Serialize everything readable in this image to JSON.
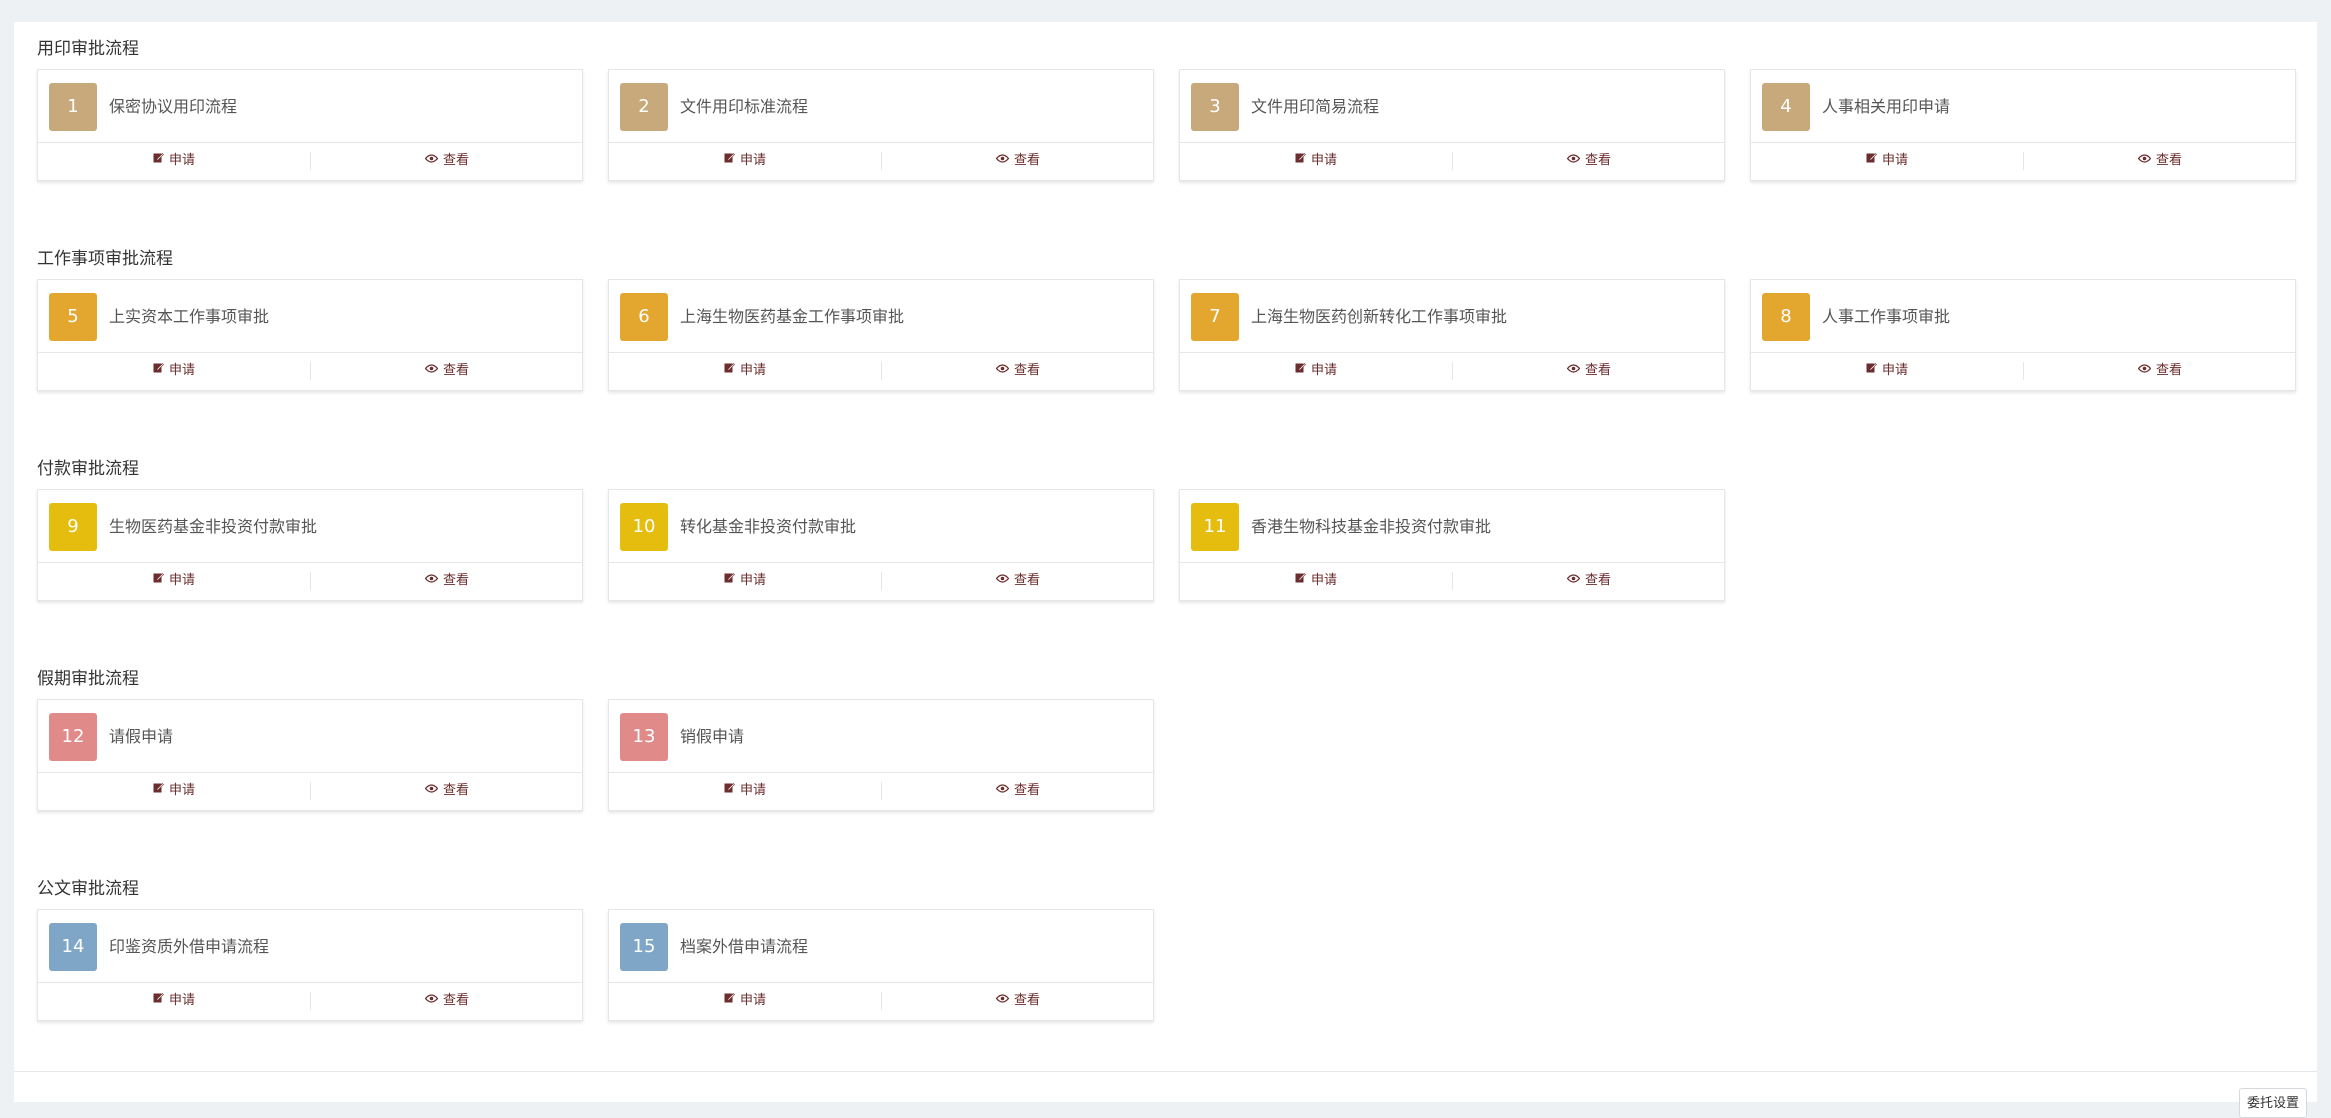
{
  "actions": {
    "apply": "申请",
    "view": "查看"
  },
  "colors": {
    "tan": "#c7a97c",
    "orange": "#e3a62f",
    "yellow": "#e4bd0e",
    "pink": "#e08a8a",
    "blue": "#7fa6c6"
  },
  "sections": [
    {
      "title": "用印审批流程",
      "color": "#c7a97c",
      "items": [
        {
          "num": "1",
          "name": "保密协议用印流程"
        },
        {
          "num": "2",
          "name": "文件用印标准流程"
        },
        {
          "num": "3",
          "name": "文件用印简易流程"
        },
        {
          "num": "4",
          "name": "人事相关用印申请"
        }
      ]
    },
    {
      "title": "工作事项审批流程",
      "color": "#e3a62f",
      "items": [
        {
          "num": "5",
          "name": "上实资本工作事项审批"
        },
        {
          "num": "6",
          "name": "上海生物医药基金工作事项审批"
        },
        {
          "num": "7",
          "name": "上海生物医药创新转化工作事项审批"
        },
        {
          "num": "8",
          "name": "人事工作事项审批"
        }
      ]
    },
    {
      "title": "付款审批流程",
      "color": "#e4bd0e",
      "items": [
        {
          "num": "9",
          "name": "生物医药基金非投资付款审批"
        },
        {
          "num": "10",
          "name": "转化基金非投资付款审批"
        },
        {
          "num": "11",
          "name": "香港生物科技基金非投资付款审批"
        }
      ]
    },
    {
      "title": "假期审批流程",
      "color": "#e08a8a",
      "items": [
        {
          "num": "12",
          "name": "请假申请"
        },
        {
          "num": "13",
          "name": "销假申请"
        }
      ]
    },
    {
      "title": "公文审批流程",
      "color": "#7fa6c6",
      "items": [
        {
          "num": "14",
          "name": "印鉴资质外借申请流程"
        },
        {
          "num": "15",
          "name": "档案外借申请流程"
        }
      ]
    }
  ],
  "footer": {
    "button_label": "委托设置"
  }
}
